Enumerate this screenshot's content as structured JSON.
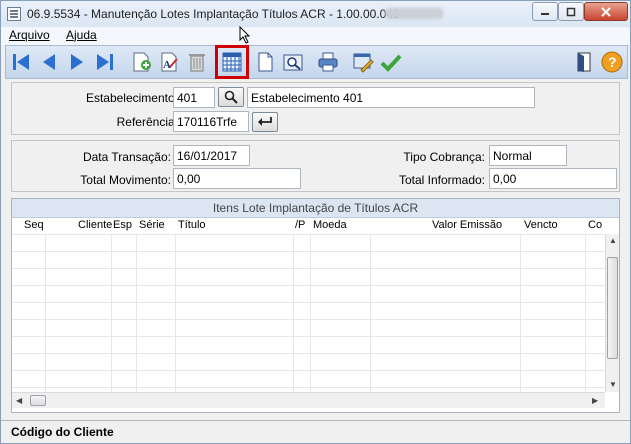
{
  "window": {
    "title": "06.9.5534 - Manutenção Lotes Implantação Títulos ACR - 1.00.00.040"
  },
  "menu": {
    "items": [
      "Arquivo",
      "Ajuda"
    ]
  },
  "toolbar": {
    "buttons": [
      "first-icon",
      "previous-icon",
      "next-icon",
      "last-icon",
      "add-record-icon",
      "edit-record-icon",
      "delete-icon",
      "calendar-grid-icon",
      "blank-document-icon",
      "search-document-icon",
      "print-icon",
      "properties-icon",
      "confirm-check-icon",
      "exit-door-icon",
      "help-icon"
    ],
    "highlight_color": "#d00000"
  },
  "header": {
    "estabelecimento_label": "Estabelecimento:",
    "estabelecimento_code": "401",
    "estabelecimento_name": "Estabelecimento 401",
    "referencia_label": "Referência:",
    "referencia_value": "170116Trfe"
  },
  "details": {
    "data_transacao_label": "Data Transação:",
    "data_transacao_value": "16/01/2017",
    "tipo_cobranca_label": "Tipo Cobrança:",
    "tipo_cobranca_value": "Normal",
    "total_movimento_label": "Total Movimento:",
    "total_movimento_value": "0,00",
    "total_informado_label": "Total Informado:",
    "total_informado_value": "0,00"
  },
  "grid": {
    "title": "Itens Lote Implantação de Títulos ACR",
    "columns": [
      "Seq",
      "Cliente",
      "Esp",
      "Série",
      "Título",
      "/P",
      "Moeda",
      "Valor Emissão",
      "Vencto",
      "Co"
    ]
  },
  "status": {
    "text": "Código do Cliente"
  }
}
